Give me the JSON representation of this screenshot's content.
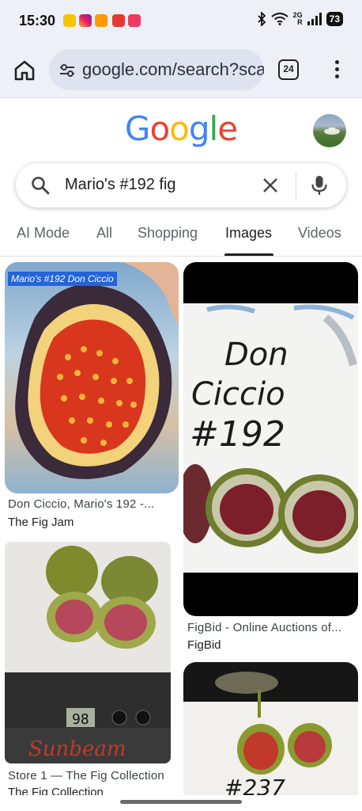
{
  "status_bar": {
    "time": "15:30",
    "network_label_top": "2G",
    "network_label_side": "R",
    "battery": "73"
  },
  "browser": {
    "url": "google.com/search?sca",
    "tab_count": "24"
  },
  "google": {
    "logo_letters": [
      "G",
      "o",
      "o",
      "g",
      "l",
      "e"
    ],
    "logo_colors": [
      "#4285F4",
      "#EA4335",
      "#FBBC05",
      "#4285F4",
      "#34A853",
      "#EA4335"
    ]
  },
  "search": {
    "query": "Mario's #192 fig"
  },
  "tabs": [
    "AI Mode",
    "All",
    "Shopping",
    "Images",
    "Videos"
  ],
  "active_tab": "Images",
  "results": [
    {
      "overlay": "Mario's #192 Don Ciccio",
      "title": "Don Ciccio, Mario's 192 -...",
      "source": "The Fig Jam"
    },
    {
      "title": "FigBid - Online Auctions of...",
      "source": "FigBid",
      "handwriting": [
        "Don",
        "Ciccio",
        "#192"
      ]
    },
    {
      "title": "Store 1 — The Fig Collection",
      "source": "The Fig Collection",
      "scale_reading": "98",
      "scale_brand": "Sunbeam"
    },
    {
      "handwriting": "#237"
    }
  ]
}
